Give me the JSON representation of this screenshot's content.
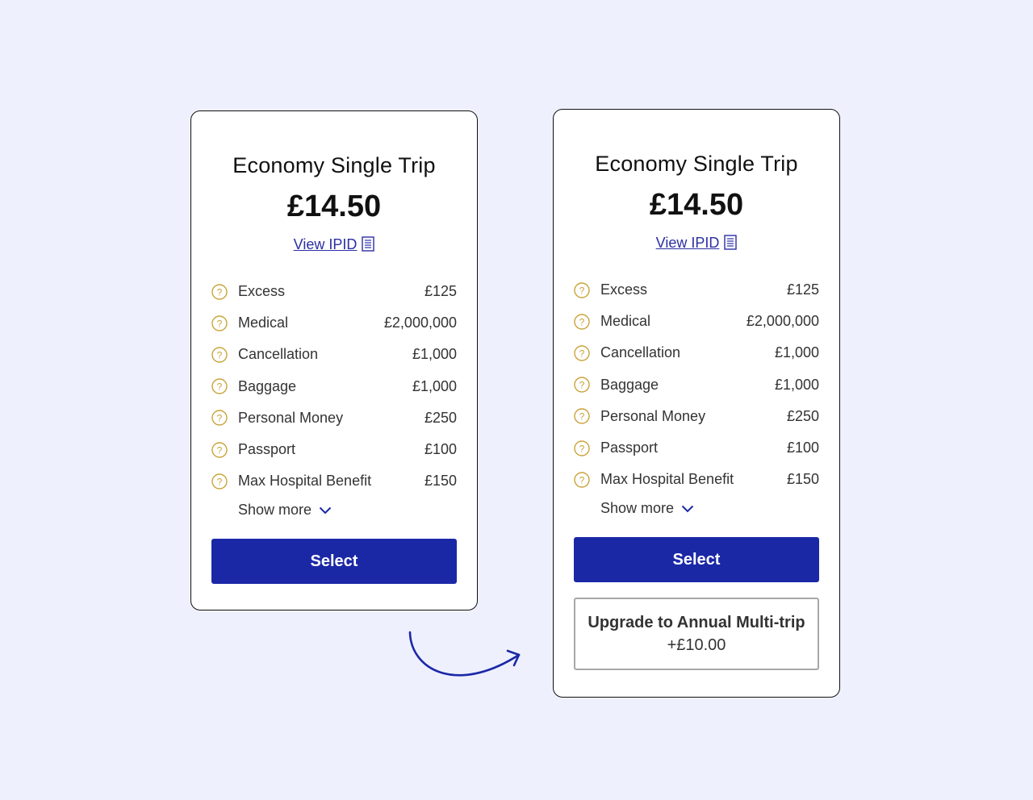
{
  "colors": {
    "background": "#eef0fd",
    "primary_button": "#1b28a6",
    "link": "#2b2ea3",
    "help_icon": "#c9a43a"
  },
  "cards": [
    {
      "title": "Economy Single Trip",
      "price": "£14.50",
      "ipid_label": "View IPID",
      "rows": [
        {
          "label": "Excess",
          "value": "£125"
        },
        {
          "label": "Medical",
          "value": "£2,000,000"
        },
        {
          "label": "Cancellation",
          "value": "£1,000"
        },
        {
          "label": "Baggage",
          "value": "£1,000"
        },
        {
          "label": "Personal Money",
          "value": "£250"
        },
        {
          "label": "Passport",
          "value": "£100"
        },
        {
          "label": "Max Hospital Benefit",
          "value": "£150"
        }
      ],
      "show_more": "Show more",
      "select_label": "Select"
    },
    {
      "title": "Economy Single Trip",
      "price": "£14.50",
      "ipid_label": "View IPID",
      "rows": [
        {
          "label": "Excess",
          "value": "£125"
        },
        {
          "label": "Medical",
          "value": "£2,000,000"
        },
        {
          "label": "Cancellation",
          "value": "£1,000"
        },
        {
          "label": "Baggage",
          "value": "£1,000"
        },
        {
          "label": "Personal Money",
          "value": "£250"
        },
        {
          "label": "Passport",
          "value": "£100"
        },
        {
          "label": "Max Hospital Benefit",
          "value": "£150"
        }
      ],
      "show_more": "Show more",
      "select_label": "Select",
      "upgrade": {
        "label": "Upgrade to Annual Multi-trip",
        "price": "+£10.00"
      }
    }
  ]
}
